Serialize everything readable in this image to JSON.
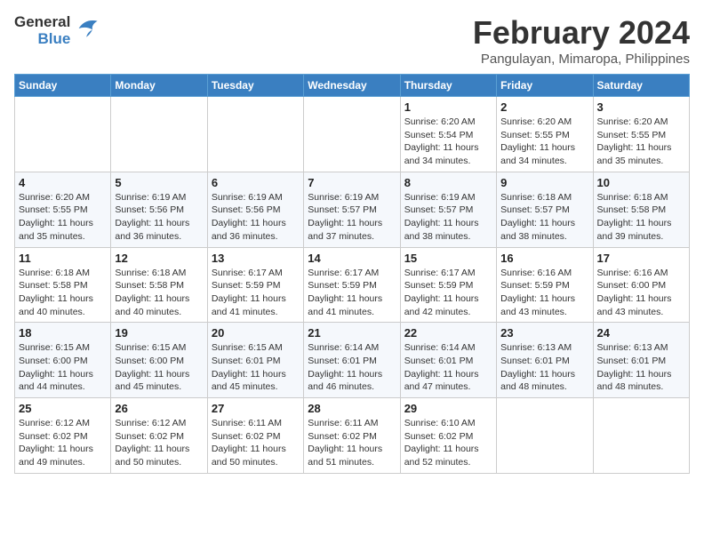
{
  "logo": {
    "line1": "General",
    "line2": "Blue"
  },
  "title": "February 2024",
  "location": "Pangulayan, Mimaropa, Philippines",
  "weekdays": [
    "Sunday",
    "Monday",
    "Tuesday",
    "Wednesday",
    "Thursday",
    "Friday",
    "Saturday"
  ],
  "weeks": [
    [
      {
        "day": "",
        "info": ""
      },
      {
        "day": "",
        "info": ""
      },
      {
        "day": "",
        "info": ""
      },
      {
        "day": "",
        "info": ""
      },
      {
        "day": "1",
        "info": "Sunrise: 6:20 AM\nSunset: 5:54 PM\nDaylight: 11 hours and 34 minutes."
      },
      {
        "day": "2",
        "info": "Sunrise: 6:20 AM\nSunset: 5:55 PM\nDaylight: 11 hours and 34 minutes."
      },
      {
        "day": "3",
        "info": "Sunrise: 6:20 AM\nSunset: 5:55 PM\nDaylight: 11 hours and 35 minutes."
      }
    ],
    [
      {
        "day": "4",
        "info": "Sunrise: 6:20 AM\nSunset: 5:55 PM\nDaylight: 11 hours and 35 minutes."
      },
      {
        "day": "5",
        "info": "Sunrise: 6:19 AM\nSunset: 5:56 PM\nDaylight: 11 hours and 36 minutes."
      },
      {
        "day": "6",
        "info": "Sunrise: 6:19 AM\nSunset: 5:56 PM\nDaylight: 11 hours and 36 minutes."
      },
      {
        "day": "7",
        "info": "Sunrise: 6:19 AM\nSunset: 5:57 PM\nDaylight: 11 hours and 37 minutes."
      },
      {
        "day": "8",
        "info": "Sunrise: 6:19 AM\nSunset: 5:57 PM\nDaylight: 11 hours and 38 minutes."
      },
      {
        "day": "9",
        "info": "Sunrise: 6:18 AM\nSunset: 5:57 PM\nDaylight: 11 hours and 38 minutes."
      },
      {
        "day": "10",
        "info": "Sunrise: 6:18 AM\nSunset: 5:58 PM\nDaylight: 11 hours and 39 minutes."
      }
    ],
    [
      {
        "day": "11",
        "info": "Sunrise: 6:18 AM\nSunset: 5:58 PM\nDaylight: 11 hours and 40 minutes."
      },
      {
        "day": "12",
        "info": "Sunrise: 6:18 AM\nSunset: 5:58 PM\nDaylight: 11 hours and 40 minutes."
      },
      {
        "day": "13",
        "info": "Sunrise: 6:17 AM\nSunset: 5:59 PM\nDaylight: 11 hours and 41 minutes."
      },
      {
        "day": "14",
        "info": "Sunrise: 6:17 AM\nSunset: 5:59 PM\nDaylight: 11 hours and 41 minutes."
      },
      {
        "day": "15",
        "info": "Sunrise: 6:17 AM\nSunset: 5:59 PM\nDaylight: 11 hours and 42 minutes."
      },
      {
        "day": "16",
        "info": "Sunrise: 6:16 AM\nSunset: 5:59 PM\nDaylight: 11 hours and 43 minutes."
      },
      {
        "day": "17",
        "info": "Sunrise: 6:16 AM\nSunset: 6:00 PM\nDaylight: 11 hours and 43 minutes."
      }
    ],
    [
      {
        "day": "18",
        "info": "Sunrise: 6:15 AM\nSunset: 6:00 PM\nDaylight: 11 hours and 44 minutes."
      },
      {
        "day": "19",
        "info": "Sunrise: 6:15 AM\nSunset: 6:00 PM\nDaylight: 11 hours and 45 minutes."
      },
      {
        "day": "20",
        "info": "Sunrise: 6:15 AM\nSunset: 6:01 PM\nDaylight: 11 hours and 45 minutes."
      },
      {
        "day": "21",
        "info": "Sunrise: 6:14 AM\nSunset: 6:01 PM\nDaylight: 11 hours and 46 minutes."
      },
      {
        "day": "22",
        "info": "Sunrise: 6:14 AM\nSunset: 6:01 PM\nDaylight: 11 hours and 47 minutes."
      },
      {
        "day": "23",
        "info": "Sunrise: 6:13 AM\nSunset: 6:01 PM\nDaylight: 11 hours and 48 minutes."
      },
      {
        "day": "24",
        "info": "Sunrise: 6:13 AM\nSunset: 6:01 PM\nDaylight: 11 hours and 48 minutes."
      }
    ],
    [
      {
        "day": "25",
        "info": "Sunrise: 6:12 AM\nSunset: 6:02 PM\nDaylight: 11 hours and 49 minutes."
      },
      {
        "day": "26",
        "info": "Sunrise: 6:12 AM\nSunset: 6:02 PM\nDaylight: 11 hours and 50 minutes."
      },
      {
        "day": "27",
        "info": "Sunrise: 6:11 AM\nSunset: 6:02 PM\nDaylight: 11 hours and 50 minutes."
      },
      {
        "day": "28",
        "info": "Sunrise: 6:11 AM\nSunset: 6:02 PM\nDaylight: 11 hours and 51 minutes."
      },
      {
        "day": "29",
        "info": "Sunrise: 6:10 AM\nSunset: 6:02 PM\nDaylight: 11 hours and 52 minutes."
      },
      {
        "day": "",
        "info": ""
      },
      {
        "day": "",
        "info": ""
      }
    ]
  ]
}
